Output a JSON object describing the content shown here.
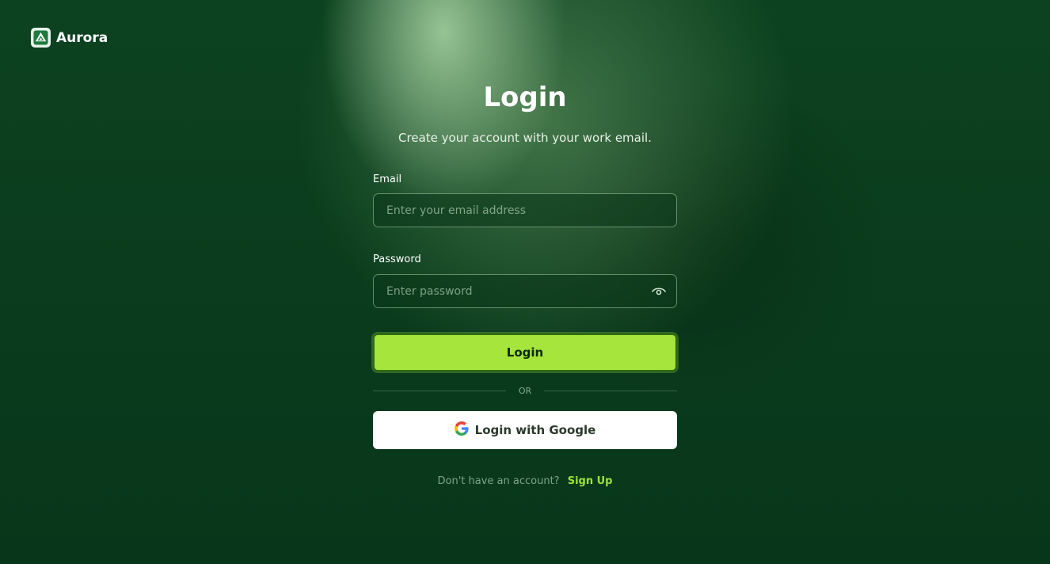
{
  "brand": {
    "name": "Aurora"
  },
  "header": {
    "title": "Login",
    "subtitle": "Create your account with your work email."
  },
  "form": {
    "email": {
      "label": "Email",
      "placeholder": "Enter your email address",
      "value": ""
    },
    "password": {
      "label": "Password",
      "placeholder": "Enter password",
      "value": ""
    },
    "login_label": "Login",
    "divider_label": "OR",
    "google_label": "Login with Google"
  },
  "footer": {
    "question": "Don't have an account?",
    "signup_label": "Sign Up"
  },
  "colors": {
    "accent": "#a6e53b",
    "background": "#0a3a1a",
    "link": "#9fe23d"
  },
  "icons": {
    "brand": "mountain-logo-icon",
    "password_toggle": "eye-icon",
    "google": "google-icon"
  }
}
